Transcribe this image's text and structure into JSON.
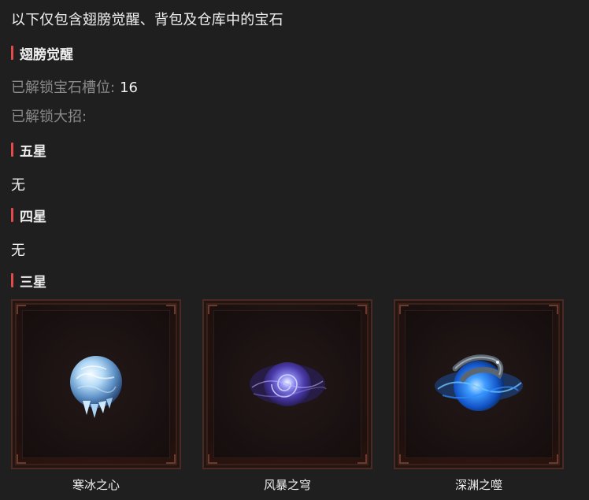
{
  "intro": "以下仅包含翅膀觉醒、背包及仓库中的宝石",
  "wing_awakening": {
    "title": "翅膀觉醒",
    "slots_label": "已解锁宝石槽位:",
    "slots_value": "16",
    "ultimate_label": "已解锁大招:"
  },
  "five_star": {
    "title": "五星",
    "content": "无"
  },
  "four_star": {
    "title": "四星",
    "content": "无"
  },
  "three_star": {
    "title": "三星",
    "gems": [
      {
        "name": "寒冰之心",
        "icon": "ice-orb-icon"
      },
      {
        "name": "风暴之穹",
        "icon": "storm-vortex-icon"
      },
      {
        "name": "深渊之噬",
        "icon": "abyss-serpent-orb-icon"
      }
    ]
  },
  "colors": {
    "background": "#1f1f1f",
    "accent_bar": "#e24b4b",
    "muted_text": "#8a8a8a"
  }
}
